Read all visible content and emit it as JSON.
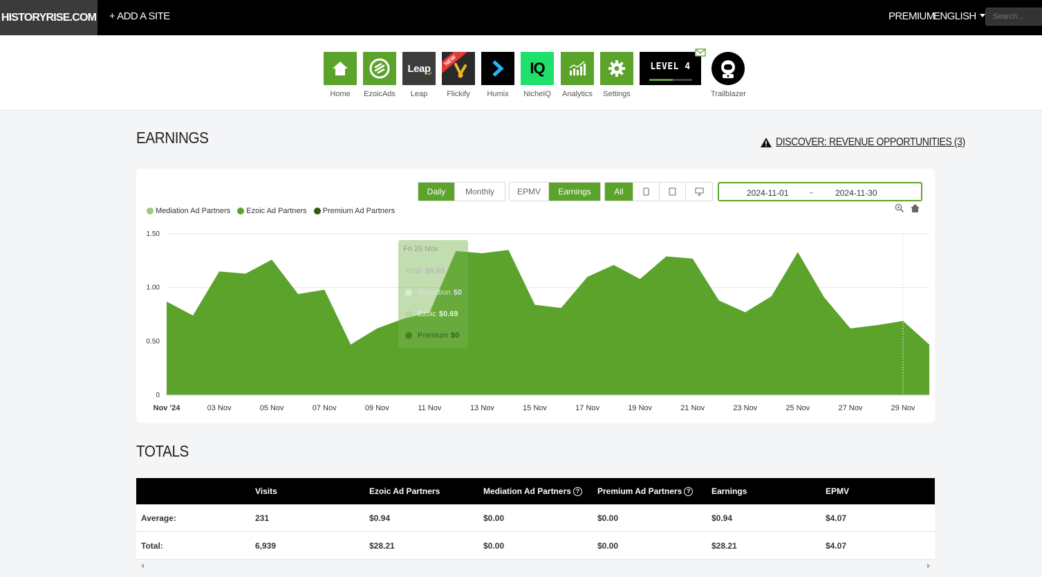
{
  "topbar": {
    "logo": "HISTORYRISE.COM",
    "add_site": "+ ADD A SITE",
    "premium": "PREMIUM",
    "language": "ENGLISH",
    "search_placeholder": "Search..."
  },
  "apps": [
    {
      "label": "Home",
      "color": "#5ba32b",
      "icon": "home-icon"
    },
    {
      "label": "EzoicAds",
      "color": "#5ba32b",
      "icon": "ezoicads-icon"
    },
    {
      "label": "Leap",
      "color": "#3c3c3c",
      "icon": "leap-icon",
      "icon_text": "Leap"
    },
    {
      "label": "Flickify",
      "color": "#2a2a2a",
      "icon": "flickify-icon",
      "badge": "NEW"
    },
    {
      "label": "Humix",
      "color": "#000000",
      "icon": "humix-icon"
    },
    {
      "label": "NicheIQ",
      "color": "#1ee06a",
      "icon": "nicheiq-icon",
      "icon_text": "IQ"
    },
    {
      "label": "Analytics",
      "color": "#5ba32b",
      "icon": "analytics-icon"
    },
    {
      "label": "Settings",
      "color": "#5ba32b",
      "icon": "gear-icon"
    },
    {
      "label": "",
      "color": "#000000",
      "icon": "level-badge",
      "icon_text": "LEVEL 4"
    },
    {
      "label": "Trailblazer",
      "color": "#000000",
      "icon": "astronaut-icon"
    }
  ],
  "earnings": {
    "title": "EARNINGS",
    "discover": "DISCOVER: REVENUE OPPORTUNITIES (3)",
    "period_buttons": [
      "Daily",
      "Monthly"
    ],
    "period_selected": "Daily",
    "metric_buttons": [
      "EPMV",
      "Earnings"
    ],
    "metric_selected": "Earnings",
    "device_buttons": [
      "All"
    ],
    "device_icons": [
      "tablet-icon",
      "mobile-icon",
      "desktop-icon"
    ],
    "date_start": "2024-11-01",
    "date_sep": "~",
    "date_end": "2024-11-30"
  },
  "tooltip": {
    "date": "Fri 29 Nov",
    "total_label": "Total",
    "total_value": "$0.69",
    "rows": [
      {
        "label": "Mediation",
        "value": "$0"
      },
      {
        "label": "Ezoic",
        "value": "$0.69"
      },
      {
        "label": "Premium",
        "value": "$0"
      }
    ]
  },
  "chart_data": {
    "type": "area",
    "series": [
      {
        "name": "Mediation Ad Partners",
        "color": "#9ccc7a",
        "values": [
          0,
          0,
          0,
          0,
          0,
          0,
          0,
          0,
          0,
          0,
          0,
          0,
          0,
          0,
          0,
          0,
          0,
          0,
          0,
          0,
          0,
          0,
          0,
          0,
          0,
          0,
          0,
          0,
          0,
          0
        ]
      },
      {
        "name": "Ezoic Ad Partners",
        "color": "#5ba32b",
        "values": [
          0.87,
          0.74,
          1.15,
          1.13,
          1.26,
          0.94,
          0.98,
          0.47,
          0.62,
          0.71,
          0.77,
          1.34,
          1.32,
          1.35,
          0.84,
          0.81,
          1.1,
          1.21,
          1.08,
          1.29,
          1.27,
          0.88,
          0.77,
          0.92,
          1.33,
          0.91,
          0.62,
          0.65,
          0.69,
          0.47
        ]
      },
      {
        "name": "Premium Ad Partners",
        "color": "#2e5a12",
        "values": [
          0,
          0,
          0,
          0,
          0,
          0,
          0,
          0,
          0,
          0,
          0,
          0,
          0,
          0,
          0,
          0,
          0,
          0,
          0,
          0,
          0,
          0,
          0,
          0,
          0,
          0,
          0,
          0,
          0,
          0
        ]
      }
    ],
    "x_labels": [
      "Nov '24",
      "03 Nov",
      "05 Nov",
      "07 Nov",
      "09 Nov",
      "11 Nov",
      "13 Nov",
      "15 Nov",
      "17 Nov",
      "19 Nov",
      "21 Nov",
      "23 Nov",
      "25 Nov",
      "27 Nov",
      "29 Nov"
    ],
    "y_ticks": [
      "0",
      "0.50",
      "1.00",
      "1.50"
    ],
    "ylim": [
      0,
      1.5
    ]
  },
  "totals": {
    "title": "TOTALS",
    "columns": [
      "",
      "Visits",
      "Ezoic Ad Partners",
      "Mediation Ad Partners",
      "Premium Ad Partners",
      "Earnings",
      "EPMV"
    ],
    "rows": [
      [
        "Average:",
        "231",
        "$0.94",
        "$0.00",
        "$0.00",
        "$0.94",
        "$4.07"
      ],
      [
        "Total:",
        "6,939",
        "$28.21",
        "$0.00",
        "$0.00",
        "$28.21",
        "$4.07"
      ]
    ]
  }
}
